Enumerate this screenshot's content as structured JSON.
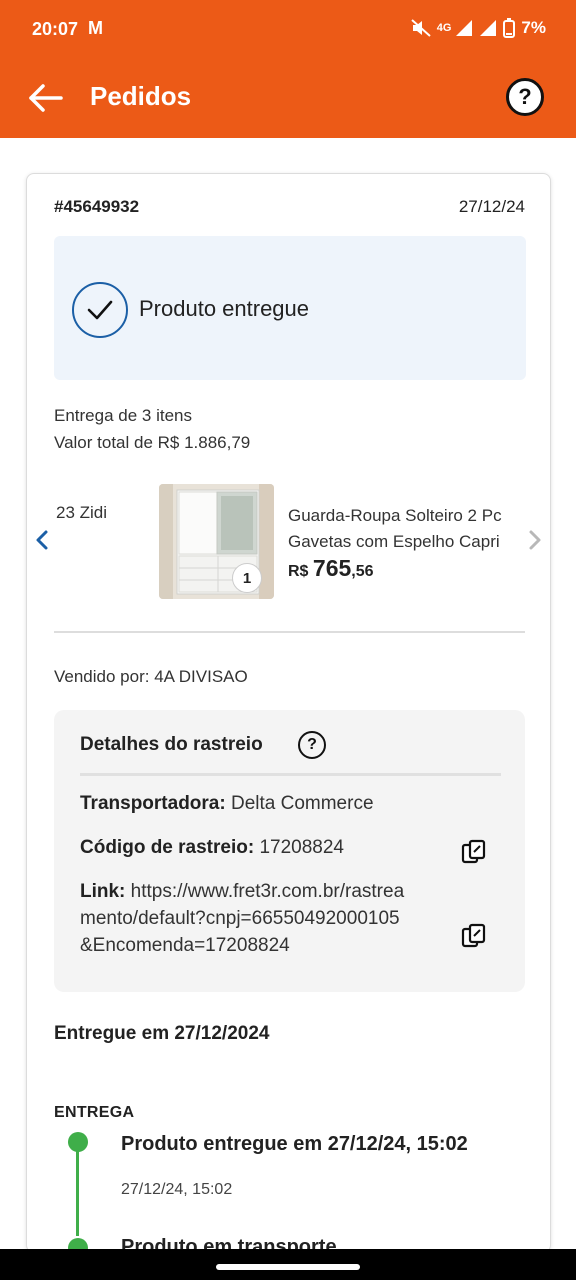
{
  "status_bar": {
    "time": "20:07",
    "mail_glyph": "M",
    "network": "4G",
    "battery": "7%"
  },
  "header": {
    "title": "Pedidos",
    "background": "#ec5a17"
  },
  "order": {
    "id": "#45649932",
    "date": "27/12/24",
    "status": "Produto entregue",
    "items_count": "Entrega de 3 itens",
    "total_value": "Valor total de R$ 1.886,79"
  },
  "carousel": {
    "prev_item_name": "23 Zidi",
    "current": {
      "name_line1": "Guarda-Roupa Solteiro 2 Pc",
      "name_line2": "Gavetas com Espelho Capri",
      "price_currency": "R$",
      "price_int": "765",
      "price_cents": ",56",
      "quantity": "1"
    }
  },
  "seller": "Vendido por: 4A DIVISAO",
  "tracking": {
    "title": "Detalhes do rastreio",
    "carrier_label": "Transportadora:",
    "carrier_value": " Delta Commerce",
    "code_label": "Código de rastreio:",
    "code_value": " 17208824",
    "link_label": "Link:",
    "link_value": " https://www.fret3r.com.br/rastreamento/default?cnpj=66550492000105&Encomenda=17208824"
  },
  "delivered_on": "Entregue em 27/12/2024",
  "timeline": {
    "section_label": "ENTREGA",
    "events": [
      {
        "title": "Produto entregue em 27/12/24, 15:02",
        "time": "27/12/24, 15:02"
      },
      {
        "title": "Produto em transporte"
      }
    ],
    "accent": "#3fae49"
  }
}
